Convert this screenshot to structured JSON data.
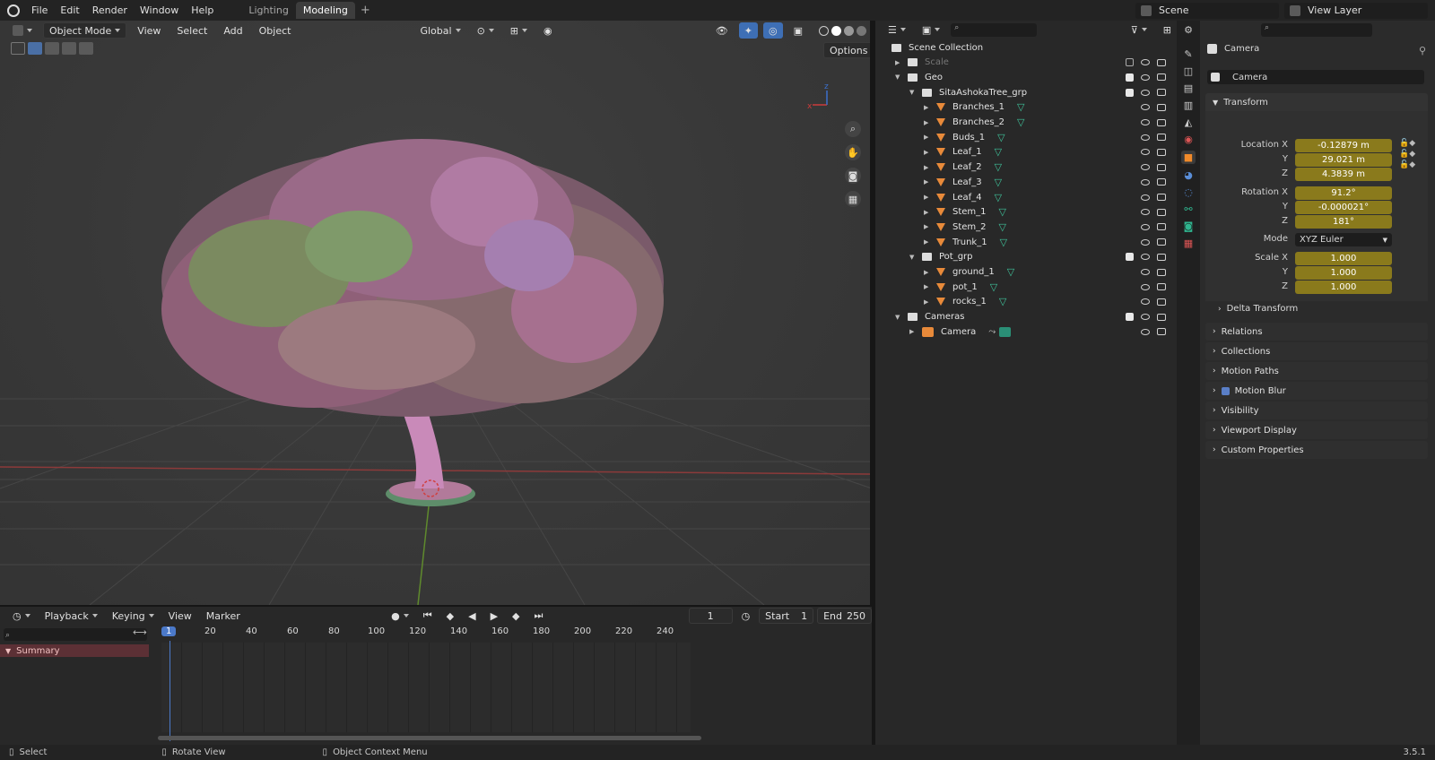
{
  "topbar": {
    "menus": [
      "File",
      "Edit",
      "Render",
      "Window",
      "Help"
    ],
    "workspaces": [
      "Lighting",
      "Modeling"
    ],
    "active_workspace": "Modeling",
    "scene": "Scene",
    "view_layer": "View Layer"
  },
  "viewport": {
    "mode": "Object Mode",
    "menus": [
      "View",
      "Select",
      "Add",
      "Object"
    ],
    "orientation": "Global",
    "options_label": "Options",
    "axis_x": "x",
    "axis_z": "z"
  },
  "outliner": {
    "rows": [
      {
        "label": "Scene Collection",
        "level": 0,
        "kind": "scene"
      },
      {
        "label": "Scale",
        "level": 1,
        "kind": "collection",
        "dim": true
      },
      {
        "label": "Geo",
        "level": 1,
        "kind": "collection"
      },
      {
        "label": "SitaAshokaTree_grp",
        "level": 2,
        "kind": "collection"
      },
      {
        "label": "Branches_1",
        "level": 3,
        "kind": "mesh"
      },
      {
        "label": "Branches_2",
        "level": 3,
        "kind": "mesh"
      },
      {
        "label": "Buds_1",
        "level": 3,
        "kind": "mesh"
      },
      {
        "label": "Leaf_1",
        "level": 3,
        "kind": "mesh"
      },
      {
        "label": "Leaf_2",
        "level": 3,
        "kind": "mesh"
      },
      {
        "label": "Leaf_3",
        "level": 3,
        "kind": "mesh"
      },
      {
        "label": "Leaf_4",
        "level": 3,
        "kind": "mesh"
      },
      {
        "label": "Stem_1",
        "level": 3,
        "kind": "mesh"
      },
      {
        "label": "Stem_2",
        "level": 3,
        "kind": "mesh"
      },
      {
        "label": "Trunk_1",
        "level": 3,
        "kind": "mesh"
      },
      {
        "label": "Pot_grp",
        "level": 2,
        "kind": "collection"
      },
      {
        "label": "ground_1",
        "level": 3,
        "kind": "mesh"
      },
      {
        "label": "pot_1",
        "level": 3,
        "kind": "mesh"
      },
      {
        "label": "rocks_1",
        "level": 3,
        "kind": "mesh"
      },
      {
        "label": "Cameras",
        "level": 1,
        "kind": "collection"
      },
      {
        "label": "Camera",
        "level": 2,
        "kind": "camera"
      }
    ]
  },
  "properties": {
    "object_name": "Camera",
    "data_name": "Camera",
    "transform_label": "Transform",
    "location_label": "Location X",
    "location": [
      "-0.12879 m",
      "29.021 m",
      "4.3839 m"
    ],
    "rotation_label": "Rotation X",
    "rotation": [
      "91.2°",
      "-0.000021°",
      "181°"
    ],
    "mode_label": "Mode",
    "mode_value": "XYZ Euler",
    "scale_label": "Scale X",
    "scale": [
      "1.000",
      "1.000",
      "1.000"
    ],
    "axis_y": "Y",
    "axis_z": "Z",
    "delta_transform": "Delta Transform",
    "panels": [
      "Relations",
      "Collections",
      "Motion Paths",
      "Motion Blur",
      "Visibility",
      "Viewport Display",
      "Custom Properties"
    ]
  },
  "timeline": {
    "menus": [
      "Playback",
      "Keying",
      "View",
      "Marker"
    ],
    "current_frame": "1",
    "start_label": "Start",
    "start_value": "1",
    "end_label": "End",
    "end_value": "250",
    "summary": "Summary",
    "ticks": [
      "1",
      "20",
      "40",
      "60",
      "80",
      "100",
      "120",
      "140",
      "160",
      "180",
      "200",
      "220",
      "240"
    ]
  },
  "status": {
    "select": "Select",
    "rotate": "Rotate View",
    "context": "Object Context Menu",
    "version": "3.5.1"
  }
}
